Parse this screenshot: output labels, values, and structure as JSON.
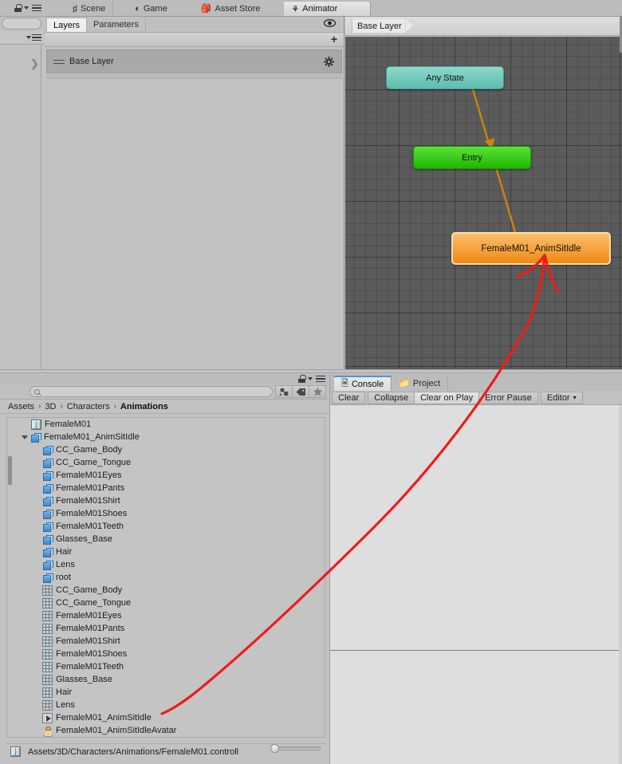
{
  "window": {
    "main_tabs": [
      {
        "label": "Scene",
        "icon": "grid-icon",
        "active": false
      },
      {
        "label": "Game",
        "icon": "gamepad-icon",
        "active": false
      },
      {
        "label": "Asset Store",
        "icon": "store-bag-icon",
        "active": false
      },
      {
        "label": "Animator",
        "icon": "animator-icon",
        "active": true
      }
    ]
  },
  "inspector_stub": {
    "lock_icon": "lock-icon",
    "menu_icon": "hamburger-menu-icon",
    "expand_icon": "chevron-right-icon"
  },
  "animator": {
    "layers_panel": {
      "tabs": [
        {
          "label": "Layers",
          "active": true
        },
        {
          "label": "Parameters",
          "active": false
        }
      ],
      "eye_icon": "eye-icon",
      "add_label": "+",
      "layers": [
        {
          "name": "Base Layer",
          "settings_icon": "gear-icon",
          "grip_icon": "drag-handle-icon"
        }
      ]
    },
    "graph": {
      "breadcrumb": "Base Layer",
      "nodes": [
        {
          "id": "any-state",
          "label": "Any State",
          "color": "#5bbdae"
        },
        {
          "id": "entry",
          "label": "Entry",
          "color": "#1fb800"
        },
        {
          "id": "state",
          "label": "FemaleM01_AnimSitIdle",
          "color": "#f08a12"
        }
      ],
      "transition_color": "#c8860d",
      "annotation_color": "#ee1c18"
    }
  },
  "project": {
    "lock_icon": "lock-icon",
    "menu_icon": "hamburger-menu-icon",
    "search": {
      "value": "",
      "placeholder": "",
      "icon": "search-icon"
    },
    "toolbar_buttons": [
      {
        "name": "filter-by-type-button",
        "icon": "object-filter-icon"
      },
      {
        "name": "filter-by-label-button",
        "icon": "tag-icon"
      },
      {
        "name": "favorites-button",
        "icon": "star-icon"
      }
    ],
    "breadcrumbs": [
      {
        "label": "Assets",
        "current": false
      },
      {
        "label": "3D",
        "current": false
      },
      {
        "label": "Characters",
        "current": false
      },
      {
        "label": "Animations",
        "current": true
      }
    ],
    "breadcrumb_separator": "›",
    "tree": [
      {
        "label": "FemaleM01",
        "icon": "animator-controller-icon",
        "indent": 1,
        "twisty": "none"
      },
      {
        "label": "FemaleM01_AnimSitIdle",
        "icon": "model-cube-icon",
        "indent": 1,
        "twisty": "open"
      },
      {
        "label": "CC_Game_Body",
        "icon": "model-cube-icon",
        "indent": 2,
        "twisty": "none"
      },
      {
        "label": "CC_Game_Tongue",
        "icon": "model-cube-icon",
        "indent": 2,
        "twisty": "none"
      },
      {
        "label": "FemaleM01Eyes",
        "icon": "model-cube-icon",
        "indent": 2,
        "twisty": "none"
      },
      {
        "label": "FemaleM01Pants",
        "icon": "model-cube-icon",
        "indent": 2,
        "twisty": "none"
      },
      {
        "label": "FemaleM01Shirt",
        "icon": "model-cube-icon",
        "indent": 2,
        "twisty": "none"
      },
      {
        "label": "FemaleM01Shoes",
        "icon": "model-cube-icon",
        "indent": 2,
        "twisty": "none"
      },
      {
        "label": "FemaleM01Teeth",
        "icon": "model-cube-icon",
        "indent": 2,
        "twisty": "none"
      },
      {
        "label": "Glasses_Base",
        "icon": "model-cube-icon",
        "indent": 2,
        "twisty": "none"
      },
      {
        "label": "Hair",
        "icon": "model-cube-icon",
        "indent": 2,
        "twisty": "none"
      },
      {
        "label": "Lens",
        "icon": "model-cube-icon",
        "indent": 2,
        "twisty": "none"
      },
      {
        "label": "root",
        "icon": "model-cube-icon",
        "indent": 2,
        "twisty": "none"
      },
      {
        "label": "CC_Game_Body",
        "icon": "mesh-icon",
        "indent": 2,
        "twisty": "none"
      },
      {
        "label": "CC_Game_Tongue",
        "icon": "mesh-icon",
        "indent": 2,
        "twisty": "none"
      },
      {
        "label": "FemaleM01Eyes",
        "icon": "mesh-icon",
        "indent": 2,
        "twisty": "none"
      },
      {
        "label": "FemaleM01Pants",
        "icon": "mesh-icon",
        "indent": 2,
        "twisty": "none"
      },
      {
        "label": "FemaleM01Shirt",
        "icon": "mesh-icon",
        "indent": 2,
        "twisty": "none"
      },
      {
        "label": "FemaleM01Shoes",
        "icon": "mesh-icon",
        "indent": 2,
        "twisty": "none"
      },
      {
        "label": "FemaleM01Teeth",
        "icon": "mesh-icon",
        "indent": 2,
        "twisty": "none"
      },
      {
        "label": "Glasses_Base",
        "icon": "mesh-icon",
        "indent": 2,
        "twisty": "none"
      },
      {
        "label": "Hair",
        "icon": "mesh-icon",
        "indent": 2,
        "twisty": "none"
      },
      {
        "label": "Lens",
        "icon": "mesh-icon",
        "indent": 2,
        "twisty": "none"
      },
      {
        "label": "FemaleM01_AnimSitIdle",
        "icon": "animation-clip-icon",
        "indent": 2,
        "twisty": "none"
      },
      {
        "label": "FemaleM01_AnimSitIdleAvatar",
        "icon": "avatar-icon",
        "indent": 2,
        "twisty": "none"
      }
    ],
    "status": {
      "icon": "animator-controller-icon",
      "path": "Assets/3D/Characters/Animations/FemaleM01.controll",
      "zoom_slider": "icon-size-slider"
    }
  },
  "console": {
    "tabs": [
      {
        "label": "Console",
        "icon": "console-icon",
        "active": true
      },
      {
        "label": "Project",
        "icon": "folder-icon",
        "active": false
      }
    ],
    "toolbar": [
      {
        "label": "Clear",
        "name": "clear-button"
      },
      {
        "label": "Collapse",
        "name": "collapse-toggle"
      },
      {
        "label": "Clear on Play",
        "name": "clear-on-play-toggle"
      },
      {
        "label": "Error Pause",
        "name": "error-pause-toggle"
      },
      {
        "label": "Editor",
        "name": "editor-dropdown",
        "dropdown": true
      }
    ],
    "dropdown_caret": "▾",
    "messages": []
  }
}
